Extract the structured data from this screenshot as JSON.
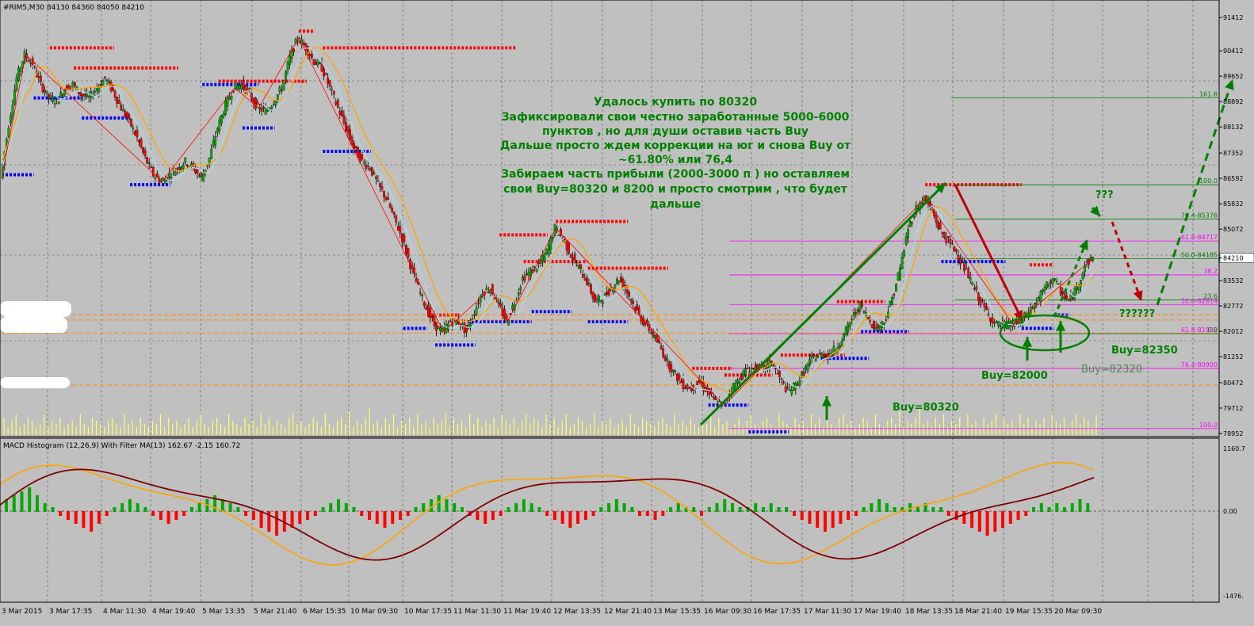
{
  "window": {
    "symbol_header": "#RIM5,M30  84130 84360 84050 84210",
    "macd_header": "MACD Histogram (12,26,9) With Filter MA(13) 162.67 -2.15 160.72"
  },
  "chart_data": [
    {
      "type": "candlestick",
      "title": "#RIM5,M30",
      "ohlc_last": {
        "open": 84130,
        "high": 84360,
        "low": 84050,
        "close": 84210
      },
      "ylim": [
        78952,
        91412
      ],
      "y_ticks": [
        "91412",
        "90412",
        "89652",
        "88892",
        "88132",
        "87352",
        "86592",
        "85832",
        "85072",
        "84210",
        "83532",
        "82772",
        "82012",
        "81252",
        "80472",
        "79712",
        "78952"
      ],
      "current_price_label": "84210",
      "x_ticks": [
        "3 Mar 2015",
        "3 Mar 17:35",
        "4 Mar 11:30",
        "4 Mar 19:40",
        "5 Mar 13:35",
        "5 Mar 21:40",
        "6 Mar 15:35",
        "10 Mar 09:30",
        "10 Mar 17:35",
        "11 Mar 11:30",
        "11 Mar 19:40",
        "12 Mar 13:35",
        "12 Mar 21:40",
        "13 Mar 15:35",
        "16 Mar 09:30",
        "16 Mar 17:35",
        "17 Mar 11:30",
        "17 Mar 19:40",
        "18 Mar 13:35",
        "18 Mar 21:40",
        "19 Mar 15:35",
        "20 Mar 09:30"
      ],
      "price_path": [
        [
          0,
          86600
        ],
        [
          1,
          88200
        ],
        [
          2,
          89600
        ],
        [
          3,
          90300
        ],
        [
          4,
          90000
        ],
        [
          5,
          89400
        ],
        [
          6,
          89000
        ],
        [
          7,
          88900
        ],
        [
          8,
          89300
        ],
        [
          9,
          89400
        ],
        [
          10,
          89100
        ],
        [
          11,
          89000
        ],
        [
          12,
          89300
        ],
        [
          13,
          89600
        ],
        [
          14,
          89200
        ],
        [
          15,
          88700
        ],
        [
          16,
          88300
        ],
        [
          17,
          87800
        ],
        [
          18,
          87200
        ],
        [
          19,
          86700
        ],
        [
          20,
          86500
        ],
        [
          21,
          86700
        ],
        [
          22,
          86900
        ],
        [
          23,
          87100
        ],
        [
          24,
          86900
        ],
        [
          25,
          86600
        ],
        [
          26,
          87200
        ],
        [
          27,
          88100
        ],
        [
          28,
          88800
        ],
        [
          29,
          89300
        ],
        [
          30,
          89400
        ],
        [
          31,
          89100
        ],
        [
          32,
          88700
        ],
        [
          33,
          88600
        ],
        [
          34,
          88900
        ],
        [
          35,
          89300
        ],
        [
          36,
          90200
        ],
        [
          37,
          90800
        ],
        [
          38,
          90500
        ],
        [
          39,
          90100
        ],
        [
          40,
          89900
        ],
        [
          41,
          89300
        ],
        [
          42,
          88700
        ],
        [
          43,
          88100
        ],
        [
          44,
          87500
        ],
        [
          45,
          87100
        ],
        [
          46,
          86900
        ],
        [
          47,
          86400
        ],
        [
          48,
          86000
        ],
        [
          49,
          85400
        ],
        [
          50,
          84800
        ],
        [
          51,
          84000
        ],
        [
          52,
          83300
        ],
        [
          53,
          82700
        ],
        [
          54,
          82200
        ],
        [
          55,
          82000
        ],
        [
          56,
          82300
        ],
        [
          57,
          82300
        ],
        [
          58,
          82000
        ],
        [
          59,
          82600
        ],
        [
          60,
          83200
        ],
        [
          61,
          83300
        ],
        [
          62,
          82800
        ],
        [
          63,
          82300
        ],
        [
          64,
          82900
        ],
        [
          65,
          83600
        ],
        [
          66,
          83800
        ],
        [
          67,
          84000
        ],
        [
          68,
          84400
        ],
        [
          69,
          85100
        ],
        [
          70,
          84800
        ],
        [
          71,
          84300
        ],
        [
          72,
          83900
        ],
        [
          73,
          83500
        ],
        [
          74,
          82900
        ],
        [
          75,
          83000
        ],
        [
          76,
          83300
        ],
        [
          77,
          83600
        ],
        [
          78,
          83200
        ],
        [
          79,
          82700
        ],
        [
          80,
          82300
        ],
        [
          81,
          82000
        ],
        [
          82,
          81600
        ],
        [
          83,
          81100
        ],
        [
          84,
          80700
        ],
        [
          85,
          80400
        ],
        [
          86,
          80300
        ],
        [
          87,
          80500
        ],
        [
          88,
          80200
        ],
        [
          89,
          79900
        ],
        [
          90,
          79800
        ],
        [
          91,
          80300
        ],
        [
          92,
          80600
        ],
        [
          93,
          80900
        ],
        [
          94,
          80900
        ],
        [
          95,
          80900
        ],
        [
          96,
          81100
        ],
        [
          97,
          80600
        ],
        [
          98,
          80200
        ],
        [
          99,
          80400
        ],
        [
          100,
          80800
        ],
        [
          101,
          81200
        ],
        [
          102,
          81300
        ],
        [
          103,
          81300
        ],
        [
          104,
          81500
        ],
        [
          105,
          81900
        ],
        [
          106,
          82400
        ],
        [
          107,
          82800
        ],
        [
          108,
          82400
        ],
        [
          109,
          82100
        ],
        [
          110,
          82300
        ],
        [
          111,
          83000
        ],
        [
          112,
          83900
        ],
        [
          113,
          85100
        ],
        [
          114,
          85700
        ],
        [
          115,
          86000
        ],
        [
          116,
          85600
        ],
        [
          117,
          85000
        ],
        [
          118,
          84700
        ],
        [
          119,
          84400
        ],
        [
          120,
          83900
        ],
        [
          121,
          83400
        ],
        [
          122,
          82900
        ],
        [
          123,
          82500
        ],
        [
          124,
          82200
        ],
        [
          125,
          82200
        ],
        [
          126,
          82200
        ],
        [
          127,
          82300
        ],
        [
          128,
          82600
        ],
        [
          129,
          82900
        ],
        [
          130,
          83300
        ],
        [
          131,
          83600
        ],
        [
          132,
          83200
        ],
        [
          133,
          82900
        ],
        [
          134,
          83300
        ],
        [
          135,
          84000
        ],
        [
          136,
          84210
        ]
      ],
      "volume_pattern": [
        3,
        5,
        2,
        4,
        6,
        2,
        3,
        5,
        4,
        2,
        3,
        6,
        2,
        4,
        3,
        5,
        2,
        3,
        4,
        2,
        6,
        3,
        2,
        5,
        4,
        3,
        2,
        4,
        5,
        3,
        2,
        6,
        3,
        4,
        2,
        5,
        3,
        2,
        4,
        3,
        6,
        2,
        5,
        3,
        4,
        2,
        3,
        5,
        2,
        4,
        6,
        3,
        2,
        4,
        5,
        3,
        2,
        6,
        4,
        3,
        2,
        5,
        3,
        4,
        2,
        6,
        3,
        5,
        2,
        4,
        3,
        2,
        5,
        6,
        3,
        4,
        2,
        3,
        5,
        4,
        2,
        6,
        3,
        2,
        4,
        5,
        3,
        7,
        2,
        4,
        3,
        5,
        8,
        3,
        4,
        2,
        5,
        3,
        6,
        2,
        4,
        3,
        5,
        2,
        6,
        3,
        4,
        2,
        5,
        3,
        4,
        6,
        2,
        5,
        3,
        4,
        2,
        6,
        3,
        5,
        2,
        4,
        3,
        5,
        2,
        6,
        4,
        3,
        5,
        2,
        4,
        6,
        3,
        5,
        4,
        2,
        6
      ],
      "right_labels": [
        "161.8",
        "100.0",
        "76.4-85376",
        "61.8-84717",
        "50.0-84185",
        "38.2",
        "23.6",
        "50.0-82814",
        "61.8-81939",
        "0.0",
        "76.4-80900",
        "100.0"
      ],
      "annotations": {
        "main_text": [
          "Удалось купить  по 80320",
          "Зафиксировали  свои честно заработанные 5000-6000",
          "пунктов , но для души оставив часть Buy",
          "Дальше просто ждем коррекции  на юг  и снова Buy от",
          "~61.80% или 76,4",
          "Забираем часть прибыли (2000-3000 п ) но оставляем",
          "свои  Buy=80320 и 8200  и просто смотрим , что будет",
          "дальше"
        ],
        "q3": "???",
        "q6": "??????",
        "buy_80320": "Buy=80320",
        "buy_82000": "Buy=82000",
        "buy_82350": "Buy=82350",
        "buy_82320": "Buy=82320"
      },
      "colors": {
        "bull": "#00aa00",
        "bear": "#ff0000",
        "resistance": "#ff0000",
        "support": "#0000ff",
        "fib": "#ff00ff",
        "trend": "#008000",
        "text": "#008000",
        "volume": "#ffff66"
      }
    },
    {
      "type": "histogram",
      "title": "MACD Histogram (12,26,9) With Filter MA(13)",
      "values_header": "162.67 -2.15 160.72",
      "ylim": [
        -1476,
        1160.7
      ],
      "y_ticks": [
        "1160.7",
        "0.00",
        "-1476."
      ],
      "bar_pattern": [
        3,
        4,
        5,
        6,
        4,
        2,
        1,
        -1,
        -2,
        -3,
        -4,
        -5,
        -3,
        -1,
        1,
        2,
        3,
        2,
        1,
        -1,
        -2,
        -3,
        -2,
        -1,
        1,
        2,
        3,
        4,
        3,
        2,
        1,
        -1,
        -2,
        -4,
        -5,
        -6,
        -5,
        -4,
        -3,
        -2,
        -1,
        1,
        2,
        3,
        2,
        1,
        -1,
        -2,
        -3,
        -4,
        -3,
        -2,
        -1,
        1,
        2,
        3,
        4,
        3,
        2,
        1,
        -1,
        -2,
        -3,
        -2,
        -1,
        1,
        2,
        3,
        2,
        1,
        -1,
        -2,
        -3,
        -4,
        -3,
        -2,
        -1,
        1,
        2,
        3,
        2,
        1,
        -1,
        -1,
        -2,
        -1,
        1,
        2,
        1,
        1,
        -1,
        1,
        2,
        3,
        2,
        1,
        1,
        2,
        1,
        2,
        1,
        1,
        -1,
        -2,
        -3,
        -4,
        -5,
        -4,
        -3,
        -2,
        -1,
        1,
        2,
        3,
        2,
        1,
        1,
        2,
        1,
        2,
        1,
        1,
        -1,
        -2,
        -3,
        -4,
        -5,
        -6,
        -5,
        -4,
        -3,
        -2,
        -1,
        1,
        2,
        1,
        2,
        1,
        2,
        3,
        2
      ],
      "colors": {
        "pos": "#00aa00",
        "neg": "#ff0000",
        "signal": "#ffa500",
        "filter": "#800000"
      }
    }
  ]
}
